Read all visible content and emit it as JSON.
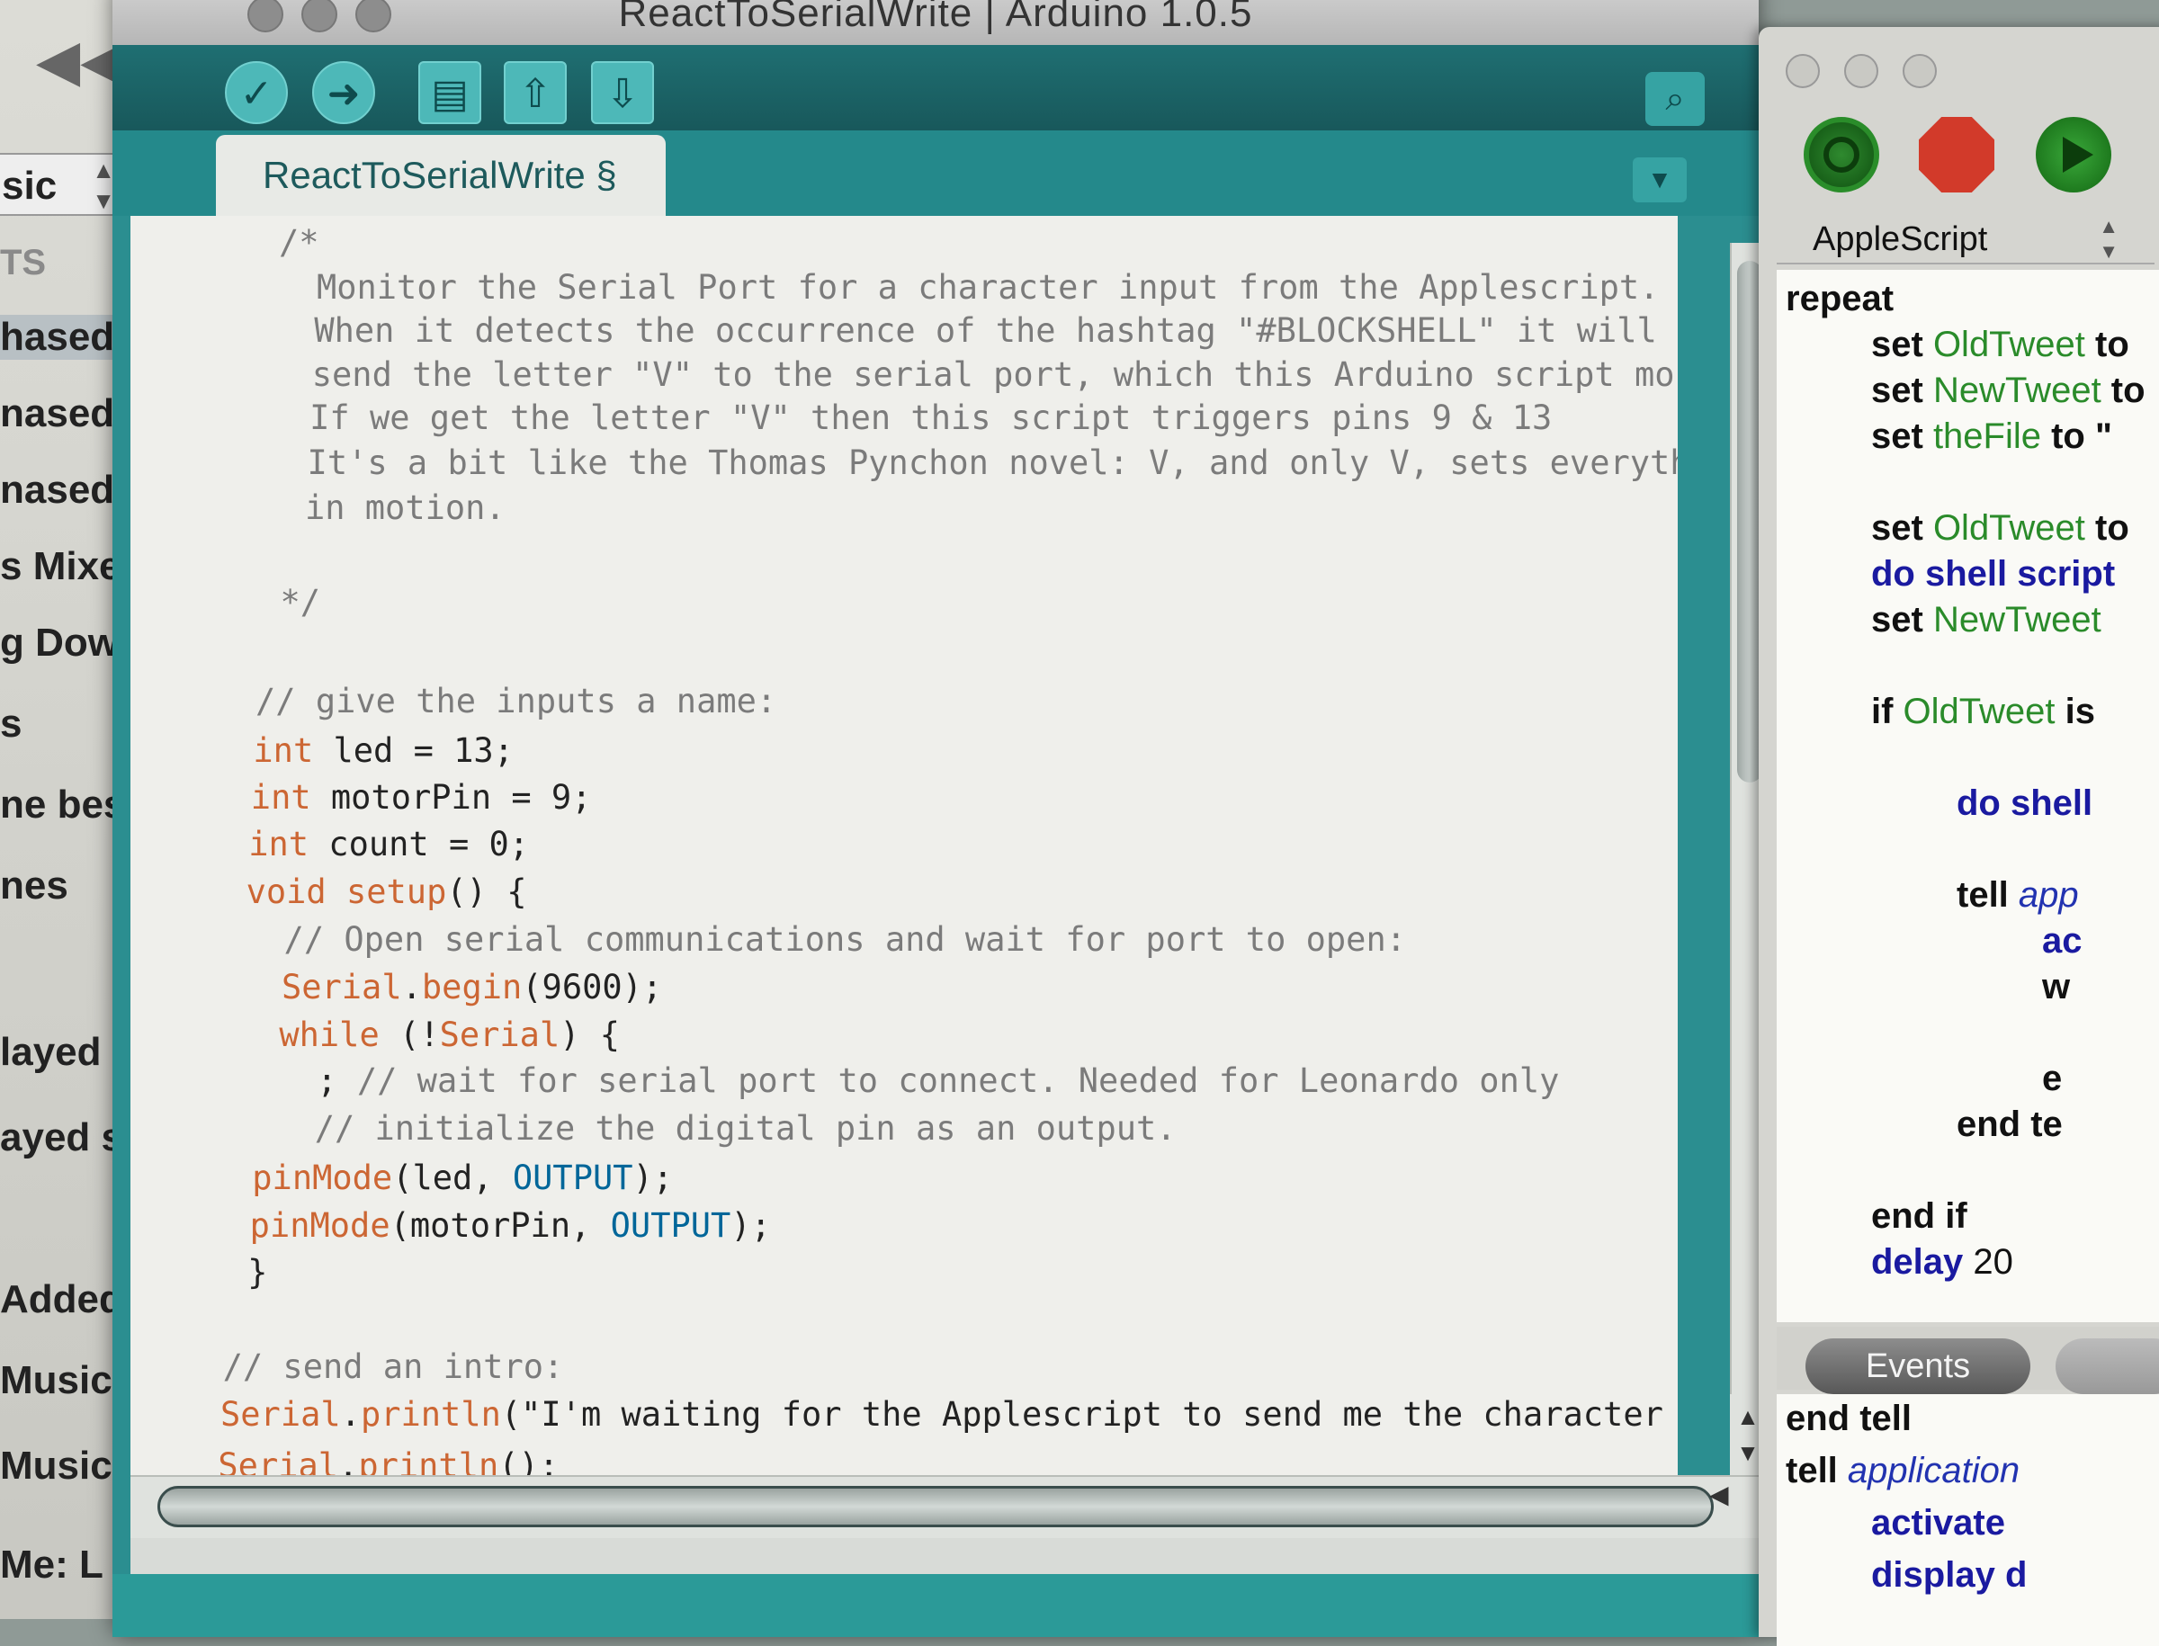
{
  "music_window": {
    "popup_label": "sic",
    "section_header": "TS",
    "items": [
      {
        "label": "hased",
        "selected": true
      },
      {
        "label": "nased on I"
      },
      {
        "label": "nased on I"
      },
      {
        "label": "s Mixes"
      },
      {
        "label": "g Down"
      },
      {
        "label": "s"
      },
      {
        "label": "ne best"
      },
      {
        "label": "nes"
      },
      {
        "label": "layed st"
      },
      {
        "label": "ayed st"
      },
      {
        "label": "Added"
      },
      {
        "label": "Music"
      },
      {
        "label": "Music"
      },
      {
        "label": "Me: L"
      }
    ]
  },
  "arduino": {
    "window_title": "ReactToSerialWrite | Arduino 1.0.5",
    "tab_label": "ReactToSerialWrite §",
    "code_lines": [
      {
        "t": "/*",
        "c": "cm"
      },
      {
        "t": "  Monitor the Serial Port for a character input from the Applescript.",
        "c": "cm"
      },
      {
        "t": "  When it detects the occurrence of the hashtag \"#BLOCKSHELL\" it will",
        "c": "cm"
      },
      {
        "t": "  send the letter \"V\" to the serial port, which this Arduino script monitors.",
        "c": "cm"
      },
      {
        "t": "  If we get the letter \"V\" then this script triggers pins 9 & 13",
        "c": "cm"
      },
      {
        "t": "  It's a bit like the Thomas Pynchon novel: V, and only V, sets everything",
        "c": "cm"
      },
      {
        "t": "  in motion.",
        "c": "cm"
      },
      {
        "t": "",
        "c": ""
      },
      {
        "t": " */",
        "c": "cm"
      },
      {
        "t": "",
        "c": ""
      },
      {
        "t": "// give the inputs a name:",
        "c": "cm"
      },
      {
        "parts": [
          {
            "t": "int",
            "c": "kw"
          },
          {
            "t": " led = 13;"
          }
        ]
      },
      {
        "parts": [
          {
            "t": "int",
            "c": "kw"
          },
          {
            "t": " motorPin = 9;"
          }
        ]
      },
      {
        "parts": [
          {
            "t": "int",
            "c": "kw"
          },
          {
            "t": " count = 0;"
          }
        ]
      },
      {
        "parts": [
          {
            "t": "void",
            "c": "kw"
          },
          {
            "t": " "
          },
          {
            "t": "setup",
            "c": "kw"
          },
          {
            "t": "() {"
          }
        ]
      },
      {
        "t": "  // Open serial communications and wait for port to open:",
        "c": "cm"
      },
      {
        "parts": [
          {
            "t": "  "
          },
          {
            "t": "Serial",
            "c": "kw"
          },
          {
            "t": "."
          },
          {
            "t": "begin",
            "c": "kw"
          },
          {
            "t": "(9600);"
          }
        ]
      },
      {
        "parts": [
          {
            "t": "  "
          },
          {
            "t": "while",
            "c": "kw"
          },
          {
            "t": " (!"
          },
          {
            "t": "Serial",
            "c": "kw"
          },
          {
            "t": ") {"
          }
        ]
      },
      {
        "parts": [
          {
            "t": "    ; "
          },
          {
            "t": "// wait for serial port to connect. Needed for Leonardo only",
            "c": "cm"
          }
        ]
      },
      {
        "t": "    // initialize the digital pin as an output.",
        "c": "cm"
      },
      {
        "parts": [
          {
            "t": " "
          },
          {
            "t": "pinMode",
            "c": "kw"
          },
          {
            "t": "(led, "
          },
          {
            "t": "OUTPUT",
            "c": "cn"
          },
          {
            "t": ");"
          }
        ]
      },
      {
        "parts": [
          {
            "t": " "
          },
          {
            "t": "pinMode",
            "c": "kw"
          },
          {
            "t": "(motorPin, "
          },
          {
            "t": "OUTPUT",
            "c": "cn"
          },
          {
            "t": ");"
          }
        ]
      },
      {
        "t": " }",
        "c": ""
      },
      {
        "t": "",
        "c": ""
      },
      {
        "t": "// send an intro:",
        "c": "cm"
      },
      {
        "parts": [
          {
            "t": "Serial",
            "c": "kw"
          },
          {
            "t": "."
          },
          {
            "t": "println",
            "c": "kw"
          },
          {
            "t": "(\"I'm waiting for the Applescript to send me the character 'V'\");"
          }
        ]
      },
      {
        "parts": [
          {
            "t": "Serial",
            "c": "kw"
          },
          {
            "t": "."
          },
          {
            "t": "println",
            "c": "kw"
          },
          {
            "t": "();"
          }
        ]
      }
    ]
  },
  "applescript": {
    "language": "AppleScript",
    "events_tab": "Events",
    "script_lines": [
      {
        "i": 0,
        "html": [
          {
            "t": "repeat"
          }
        ]
      },
      {
        "i": 1,
        "html": [
          {
            "t": "set "
          },
          {
            "t": "OldTweet",
            "c": "v"
          },
          {
            "t": " to"
          }
        ]
      },
      {
        "i": 1,
        "html": [
          {
            "t": "set "
          },
          {
            "t": "NewTweet",
            "c": "v"
          },
          {
            "t": " to"
          }
        ]
      },
      {
        "i": 1,
        "html": [
          {
            "t": "set "
          },
          {
            "t": "theFile",
            "c": "v"
          },
          {
            "t": " to \""
          }
        ]
      },
      {
        "i": -1,
        "html": []
      },
      {
        "i": 1,
        "html": [
          {
            "t": "set "
          },
          {
            "t": "OldTweet",
            "c": "v"
          },
          {
            "t": " to"
          }
        ]
      },
      {
        "i": 1,
        "html": [
          {
            "t": "do shell script",
            "c": "app"
          }
        ]
      },
      {
        "i": 1,
        "html": [
          {
            "t": "set "
          },
          {
            "t": "NewTweet",
            "c": "v"
          }
        ]
      },
      {
        "i": -1,
        "html": []
      },
      {
        "i": 1,
        "html": [
          {
            "t": "if "
          },
          {
            "t": "OldTweet",
            "c": "v"
          },
          {
            "t": " is"
          }
        ]
      },
      {
        "i": -1,
        "html": []
      },
      {
        "i": 2,
        "html": [
          {
            "t": "do shell",
            "c": "app"
          }
        ]
      },
      {
        "i": -1,
        "html": []
      },
      {
        "i": 2,
        "html": [
          {
            "t": "tell "
          },
          {
            "t": "app",
            "c": "it"
          }
        ]
      },
      {
        "i": 3,
        "html": [
          {
            "t": "ac",
            "c": "app"
          }
        ]
      },
      {
        "i": 3,
        "html": [
          {
            "t": "w"
          }
        ]
      },
      {
        "i": -1,
        "html": []
      },
      {
        "i": 3,
        "html": [
          {
            "t": "e"
          }
        ]
      },
      {
        "i": 2,
        "html": [
          {
            "t": "end te"
          }
        ]
      },
      {
        "i": -1,
        "html": []
      },
      {
        "i": 1,
        "html": [
          {
            "t": "end if"
          }
        ]
      },
      {
        "i": 1,
        "html": [
          {
            "t": "delay",
            "c": "app"
          },
          {
            "t": " 20",
            "c": "n"
          }
        ]
      }
    ],
    "log_lines": [
      {
        "i": 0,
        "html": [
          {
            "t": "end tell"
          }
        ]
      },
      {
        "i": 0,
        "html": [
          {
            "t": "tell "
          },
          {
            "t": "application",
            "c": "it"
          }
        ]
      },
      {
        "i": 1,
        "html": [
          {
            "t": "activate",
            "c": "app"
          }
        ]
      },
      {
        "i": 1,
        "html": [
          {
            "t": "display d",
            "c": "app"
          }
        ]
      }
    ]
  },
  "colors": {
    "arduino_teal": "#2b8e90",
    "comment": "#7b7b7b",
    "keyword": "#cc6633",
    "constant": "#006699"
  }
}
